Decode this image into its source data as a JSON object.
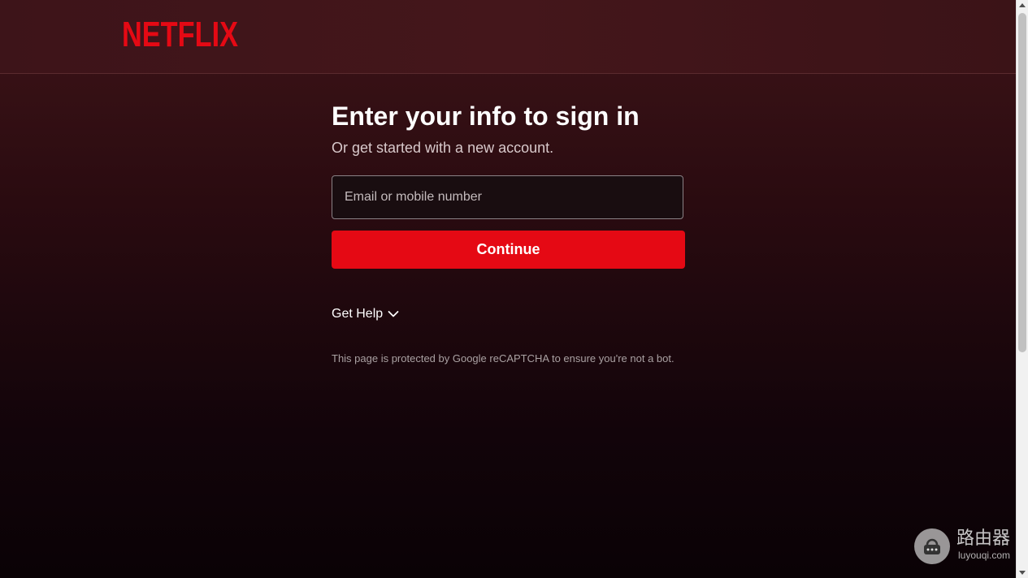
{
  "header": {
    "logo_text": "NETFLIX",
    "brand_color": "#e50914"
  },
  "signin": {
    "title": "Enter your info to sign in",
    "subtitle": "Or get started with a new account.",
    "email_placeholder": "Email or mobile number",
    "email_value": "",
    "continue_label": "Continue",
    "get_help_label": "Get Help",
    "get_help_icon": "chevron-down-icon",
    "recaptcha_notice": "This page is protected by Google reCAPTCHA to ensure you're not a bot."
  },
  "watermark": {
    "cn_text": "路由器",
    "site_text": "luyouqi.com",
    "icon": "router-lock-icon"
  }
}
